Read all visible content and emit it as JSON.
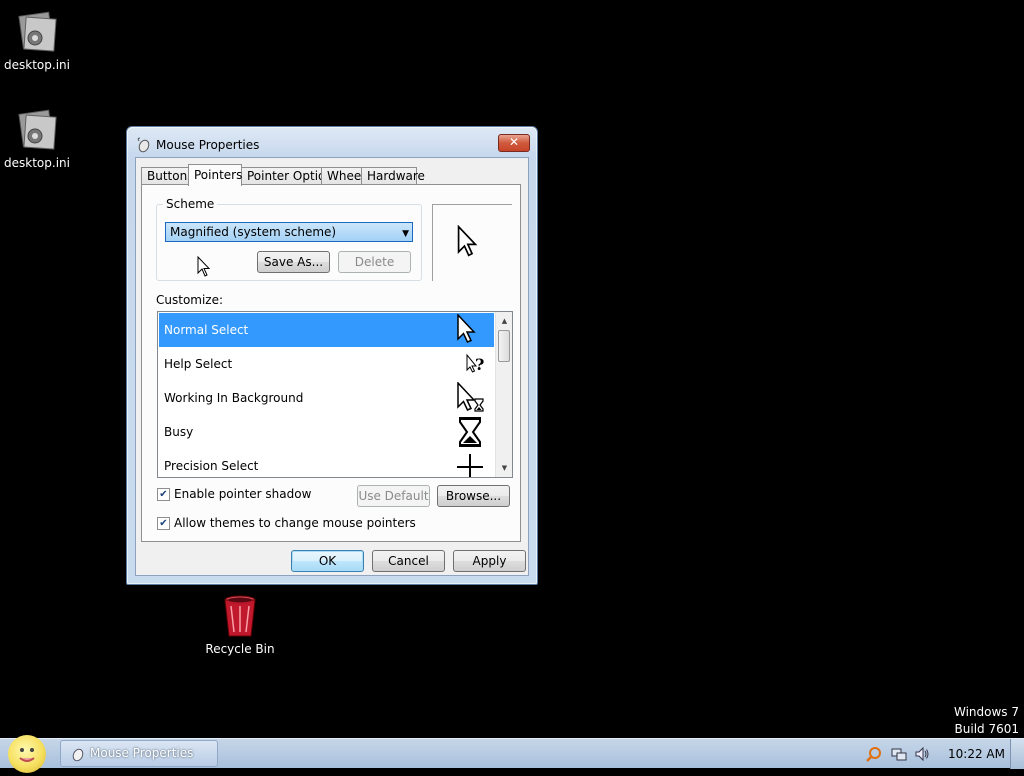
{
  "desktop": {
    "icons": [
      {
        "label": "desktop.ini",
        "icon": "ini-file-icon"
      },
      {
        "label": "desktop.ini",
        "icon": "ini-file-icon"
      },
      {
        "label": "Recycle Bin",
        "icon": "recycle-bin-icon"
      }
    ],
    "os_name": "Windows 7",
    "build": "Build 7601"
  },
  "window": {
    "title": "Mouse Properties",
    "close_glyph": "✕",
    "tabs": [
      {
        "label": "Buttons",
        "active": false
      },
      {
        "label": "Pointers",
        "active": true
      },
      {
        "label": "Pointer Options",
        "active": false
      },
      {
        "label": "Wheel",
        "active": false
      },
      {
        "label": "Hardware",
        "active": false
      }
    ],
    "scheme": {
      "legend": "Scheme",
      "selected": "Magnified (system scheme)",
      "save_as_label": "Save As...",
      "delete_label": "Delete"
    },
    "customize_label": "Customize:",
    "cursors": [
      {
        "name": "Normal Select",
        "icon": "arrow-cursor-icon",
        "selected": true
      },
      {
        "name": "Help Select",
        "icon": "help-cursor-icon",
        "selected": false
      },
      {
        "name": "Working In Background",
        "icon": "working-cursor-icon",
        "selected": false
      },
      {
        "name": "Busy",
        "icon": "hourglass-cursor-icon",
        "selected": false
      },
      {
        "name": "Precision Select",
        "icon": "crosshair-cursor-icon",
        "selected": false
      }
    ],
    "enable_shadow": {
      "label": "Enable pointer shadow",
      "checked": true
    },
    "allow_themes": {
      "label": "Allow themes to change mouse pointers",
      "checked": true
    },
    "use_default_label": "Use Default",
    "browse_label": "Browse...",
    "ok_label": "OK",
    "cancel_label": "Cancel",
    "apply_label": "Apply"
  },
  "taskbar": {
    "task_label": "Mouse Properties",
    "clock": "10:22 AM"
  },
  "colors": {
    "selection": "#3399ff",
    "desktop_bg": "#000000",
    "taskbar": "#b3c8e2"
  }
}
